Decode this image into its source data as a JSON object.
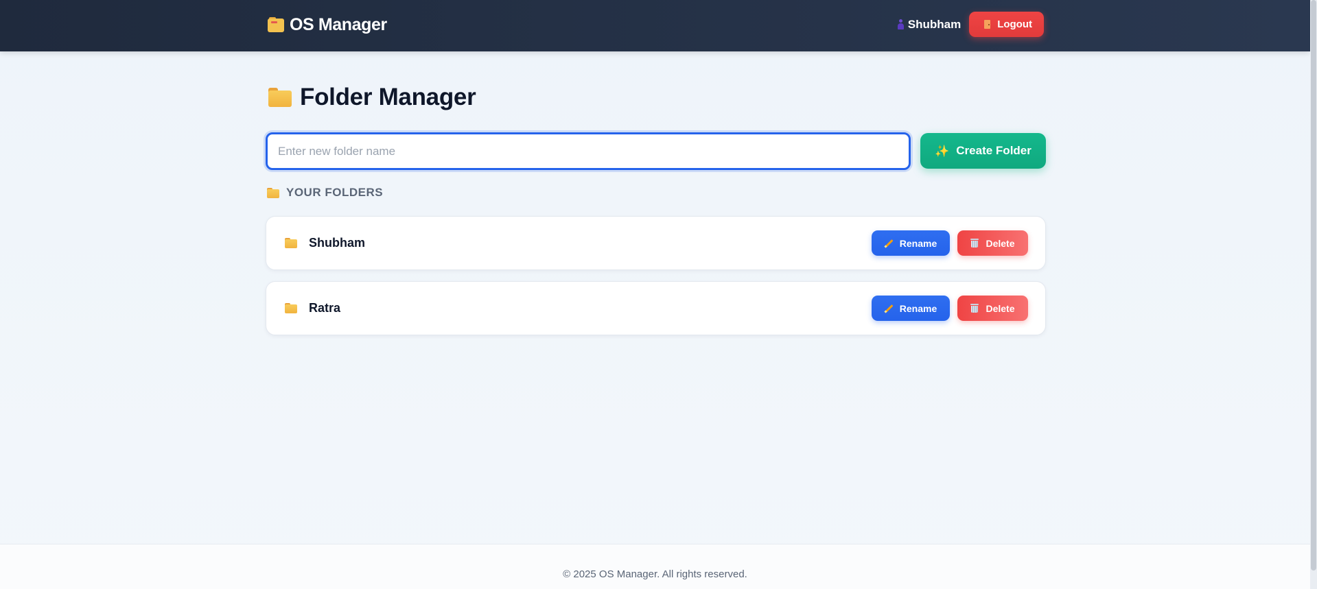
{
  "header": {
    "brand": "OS Manager",
    "brand_icon": "card-index-dividers-icon",
    "user": {
      "name": "Shubham",
      "icon": "user-icon"
    },
    "logout": {
      "label": "Logout",
      "icon": "door-icon"
    }
  },
  "main": {
    "title": "Folder Manager",
    "title_icon": "folder-icon",
    "input": {
      "placeholder": "Enter new folder name",
      "value": ""
    },
    "create_button": {
      "label": "Create Folder",
      "icon": "sparkles-icon"
    },
    "section_label": "YOUR FOLDERS",
    "folders": [
      {
        "name": "Shubham",
        "rename_label": "Rename",
        "delete_label": "Delete"
      },
      {
        "name": "Ratra",
        "rename_label": "Rename",
        "delete_label": "Delete"
      }
    ]
  },
  "footer": {
    "text": "© 2025 OS Manager. All rights reserved."
  },
  "colors": {
    "header_bg": "#1f2a3d",
    "primary": "#2563eb",
    "success": "#10b981",
    "danger": "#ef4444",
    "folder": "#f4bb46"
  }
}
